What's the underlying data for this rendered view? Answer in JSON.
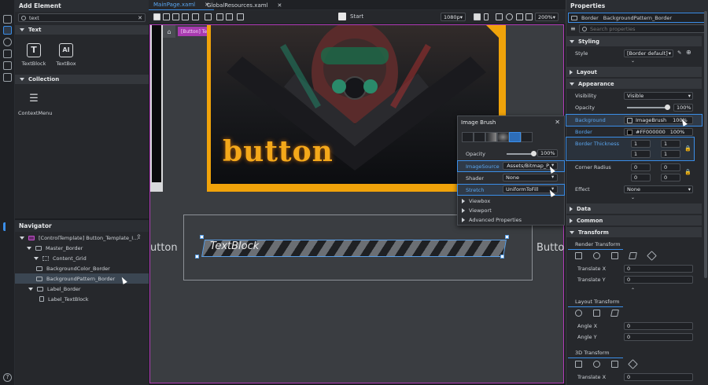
{
  "left_panel": {
    "title": "Add Element",
    "search_value": "text",
    "sections": [
      {
        "label": "Text",
        "items": [
          "TextBlock",
          "TextBox"
        ]
      },
      {
        "label": "Collection",
        "items": [
          "ContextMenu"
        ]
      }
    ]
  },
  "navigator": {
    "title": "Navigator",
    "items": [
      "[ControlTemplate] Button_Template_I...",
      "Master_Border",
      "Content_Grid",
      "BackgroundColor_Border",
      "BackgroundPattern_Border",
      "Label_Border",
      "Label_TextBlock"
    ]
  },
  "tabs": [
    "MainPage.xaml",
    "GlobalResources.xaml"
  ],
  "toolbar": {
    "start": "Start",
    "resolution": "1080p",
    "zoom": "200%"
  },
  "canvas": {
    "breadcrumb": "[Button] Template",
    "art_text": "button",
    "side_left": "utton",
    "side_right": "Butto",
    "textblock": "TextBlock"
  },
  "image_brush": {
    "title": "Image Brush",
    "opacity_label": "Opacity",
    "opacity_value": "100%",
    "image_source_label": "ImageSource",
    "image_source_value": "Assets/Bitmap_P",
    "shader_label": "Shader",
    "shader_value": "None",
    "stretch_label": "Stretch",
    "stretch_value": "UniformToFill",
    "expanders": [
      "Viewbox",
      "Viewport",
      "Advanced Properties"
    ]
  },
  "properties": {
    "title": "Properties",
    "type": "Border",
    "name": "BackgroundPattern_Border",
    "search_placeholder": "Search properties",
    "styling": "Styling",
    "style_label": "Style",
    "style_value": "[Border default]",
    "layout": "Layout",
    "appearance": "Appearance",
    "visibility_label": "Visibility",
    "visibility_value": "Visible",
    "opacity_label": "Opacity",
    "opacity_value": "100%",
    "background_label": "Background",
    "background_value": "ImageBrush",
    "background_pct": "100%",
    "border_label": "Border",
    "border_value": "#FF000000",
    "border_pct": "100%",
    "thickness_label": "Border Thickness",
    "thickness_values": [
      "1",
      "1",
      "1",
      "1"
    ],
    "corner_label": "Corner Radius",
    "corner_values": [
      "0",
      "0",
      "0",
      "0"
    ],
    "effect_label": "Effect",
    "effect_value": "None",
    "data": "Data",
    "common": "Common",
    "transform": "Transform",
    "render_transform": "Render Transform",
    "translate_x": "Translate X",
    "translate_x_value": "0",
    "translate_y": "Translate Y",
    "translate_y_value": "0",
    "layout_transform": "Layout Transform",
    "angle_x": "Angle X",
    "angle_x_value": "0",
    "angle_y": "Angle Y",
    "angle_y_value": "0",
    "transform_3d": "3D Transform",
    "t3d_translate_x": "Translate X",
    "t3d_translate_x_value": "0"
  }
}
